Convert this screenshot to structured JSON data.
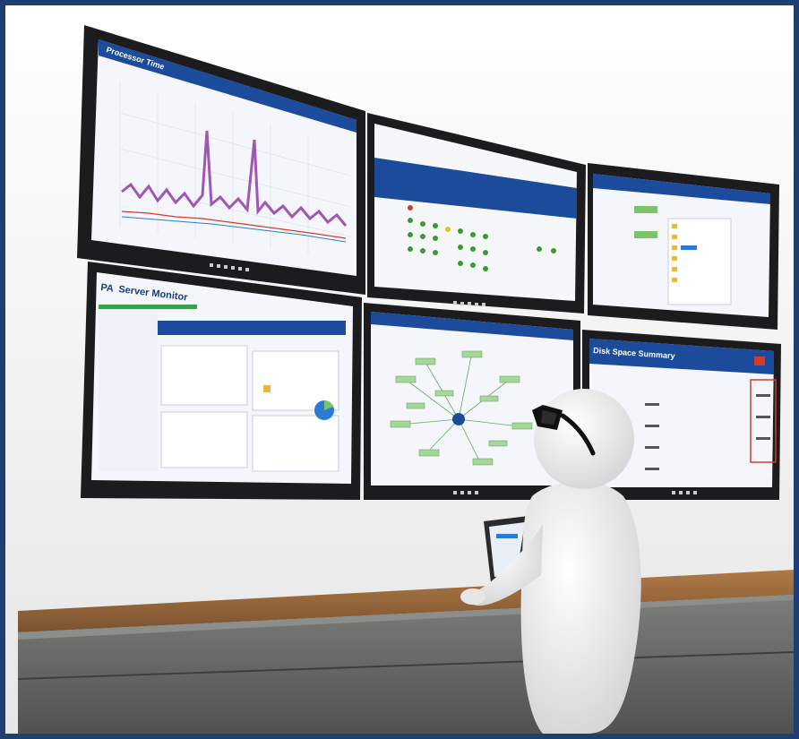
{
  "scene": {
    "description_tag": "monitoring wall",
    "colors": {
      "frame": "#1f3f73",
      "bezel": "#1c1c1e",
      "app_header": "#1c4b9c",
      "desk_top": "#9b6a3c",
      "cabinet": "#6f716f",
      "figure": "#f2f2f2"
    }
  },
  "screens": {
    "top_left": {
      "title": "Processor Time"
    },
    "bottom_left": {
      "logo": "PA",
      "title": "Server Monitor"
    },
    "bottom_right": {
      "title": "Disk Space Summary"
    }
  }
}
